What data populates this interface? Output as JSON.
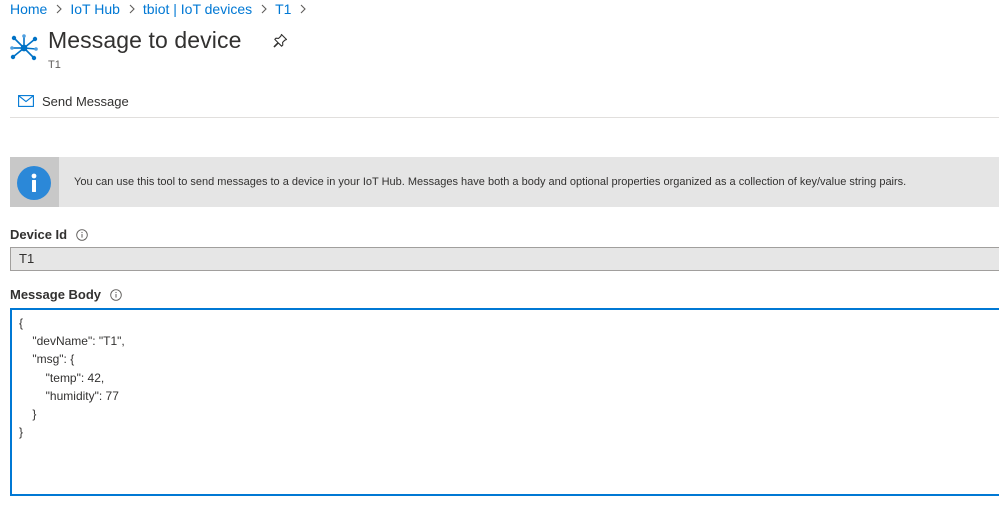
{
  "breadcrumb": {
    "items": [
      "Home",
      "IoT Hub",
      "tbiot | IoT devices",
      "T1"
    ]
  },
  "header": {
    "title": "Message to device",
    "subtitle": "T1",
    "icon": "iot-hub-icon",
    "pin_icon": "pin-icon"
  },
  "toolbar": {
    "send_message_label": "Send Message",
    "send_icon": "envelope-icon"
  },
  "info_banner": {
    "text": "You can use this tool to send messages to a device in your IoT Hub. Messages have both a body and optional properties organized as a collection of key/value string pairs."
  },
  "device_id": {
    "label": "Device Id",
    "value": "T1"
  },
  "message_body": {
    "label": "Message Body",
    "value": "{\n    \"devName\": \"T1\",\n    \"msg\": {\n        \"temp\": 42,\n        \"humidity\": 77\n    }\n}"
  },
  "colors": {
    "accent": "#0078d4",
    "info_icon": "#2b88d8",
    "banner_bg": "#e5e5e5",
    "input_bg": "#e6e6e6"
  }
}
